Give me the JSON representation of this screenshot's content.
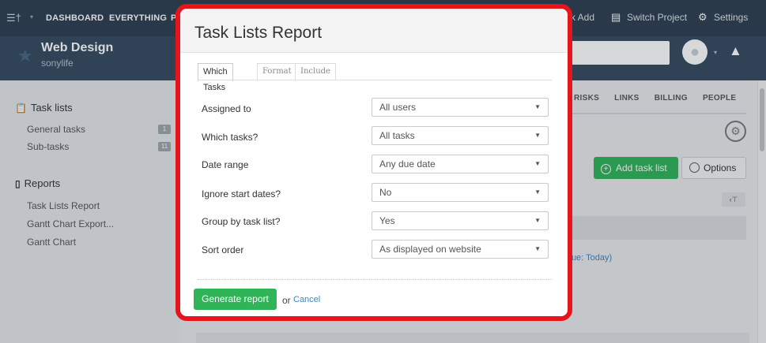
{
  "topnav": {
    "items": [
      "DASHBOARD",
      "EVERYTHING"
    ],
    "partial_item": "P",
    "quick_add": "k Add",
    "switch_project": "Switch Project",
    "settings": "Settings"
  },
  "project": {
    "title": "Web Design",
    "subtitle": "sonylife"
  },
  "sidebar": {
    "task_lists_heading": "Task lists",
    "items": [
      {
        "label": "General tasks",
        "count": "1"
      },
      {
        "label": "Sub-tasks",
        "count": "11"
      }
    ],
    "reports_heading": "Reports",
    "reports": [
      "Task Lists Report",
      "Gantt Chart Export...",
      "Gantt Chart"
    ]
  },
  "main": {
    "tabs": [
      "RISKS",
      "LINKS",
      "BILLING",
      "PEOPLE"
    ],
    "add_task_list": "Add task list",
    "options": "Options",
    "due_text": "Due: Today)"
  },
  "modal": {
    "title": "Task Lists Report",
    "tabs": [
      "Which Tasks",
      "Format",
      "Include"
    ],
    "fields": [
      {
        "label": "Assigned to",
        "value": "All users"
      },
      {
        "label": "Which tasks?",
        "value": "All tasks"
      },
      {
        "label": "Date range",
        "value": "Any due date"
      },
      {
        "label": "Ignore start dates?",
        "value": "No"
      },
      {
        "label": "Group by task list?",
        "value": "Yes"
      },
      {
        "label": "Sort order",
        "value": "As displayed on website"
      }
    ],
    "generate_button": "Generate report",
    "or_text": "or",
    "cancel": "Cancel"
  },
  "colors": {
    "nav_bg": "#2d3e50",
    "project_bar_bg": "#34495e",
    "accent_green": "#2fb458",
    "highlight_red": "#e8141c",
    "link_blue": "#3a86c8"
  }
}
